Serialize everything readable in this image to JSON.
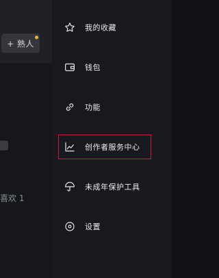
{
  "profile": {
    "friend_button_label": "+ 熟人",
    "likes_text": "喜欢 1"
  },
  "menu": {
    "items": [
      {
        "label": "我的收藏",
        "icon": "star-icon"
      },
      {
        "label": "钱包",
        "icon": "wallet-icon"
      },
      {
        "label": "功能",
        "icon": "link-icon"
      },
      {
        "label": "创作者服务中心",
        "icon": "chart-icon"
      },
      {
        "label": "未成年保护工具",
        "icon": "umbrella-icon"
      },
      {
        "label": "设置",
        "icon": "settings-icon"
      }
    ]
  },
  "colors": {
    "highlight_border": "#c4212b",
    "notification_dot": "#f0b429"
  }
}
